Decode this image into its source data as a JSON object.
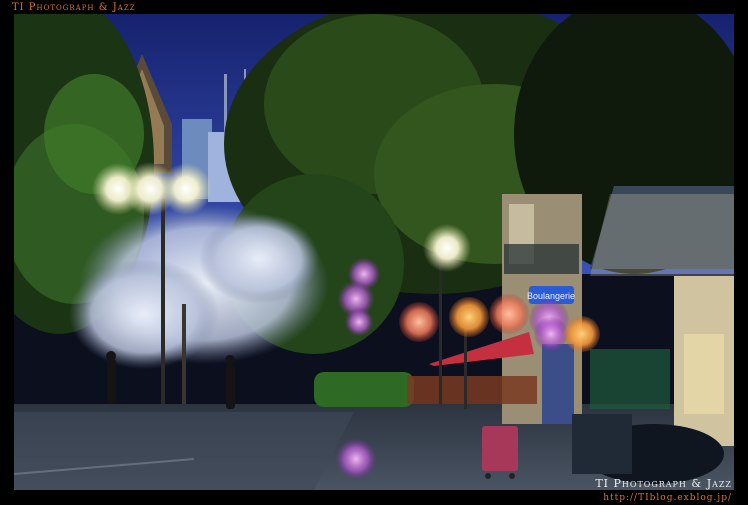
{
  "captions": {
    "top": "TI Photograph & Jazz",
    "bottom": "TI Photograph & Jazz",
    "url": "http://TIblog.exblog.jp/"
  },
  "sign_text": "Boulangerie",
  "colors": {
    "sky": "#1d2c7a",
    "foliage": "#1f3a18",
    "lamp_glow": "#f3f0c8",
    "caption_accent": "#e0722a"
  }
}
